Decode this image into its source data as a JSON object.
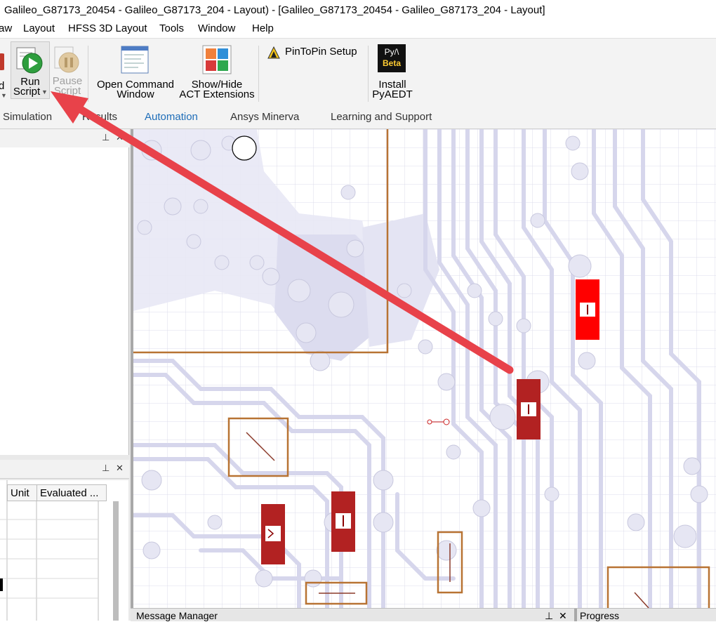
{
  "window": {
    "title": "Galileo_G87173_20454 - Galileo_G87173_204 - Layout) - [Galileo_G87173_20454 - Galileo_G87173_204 - Layout]"
  },
  "menu": {
    "items": [
      "aw",
      "Layout",
      "HFSS 3D Layout",
      "Tools",
      "Window",
      "Help"
    ]
  },
  "ribbon": {
    "record_label_partial": "d",
    "run_script": {
      "line1": "Run",
      "line2": "Script"
    },
    "pause_script": {
      "line1": "Pause",
      "line2": "Script"
    },
    "open_command": {
      "line1": "Open Command",
      "line2": "Window"
    },
    "show_hide": {
      "line1": "Show/Hide",
      "line2": "ACT Extensions"
    },
    "pintopin": {
      "label": "PinToPin Setup"
    },
    "pyaedt_badge": {
      "top": "Py/\\",
      "bottom": "Beta"
    },
    "install_pyaedt": {
      "line1": "Install",
      "line2": "PyAEDT"
    }
  },
  "tabs": [
    {
      "label": "Simulation"
    },
    {
      "label": "Results"
    },
    {
      "label": "Automation",
      "active": true
    },
    {
      "label": "Ansys Minerva"
    },
    {
      "label": "Learning and Support"
    }
  ],
  "properties_table": {
    "columns": [
      "Unit",
      "Evaluated ..."
    ]
  },
  "bottom_panels": {
    "message_manager": "Message Manager",
    "progress": "Progress"
  },
  "icons": {
    "panel_pin": "pin-icon",
    "panel_close": "close-icon",
    "dropdown": "dropdown-arrow-icon"
  },
  "colors": {
    "accent_tab": "#1e6db8",
    "board_outline": "#b87333",
    "component_red": "#b22222",
    "component_selected": "#ff0000",
    "trace_fill": "#e6e6f5",
    "annotation_arrow": "#e8424a"
  }
}
